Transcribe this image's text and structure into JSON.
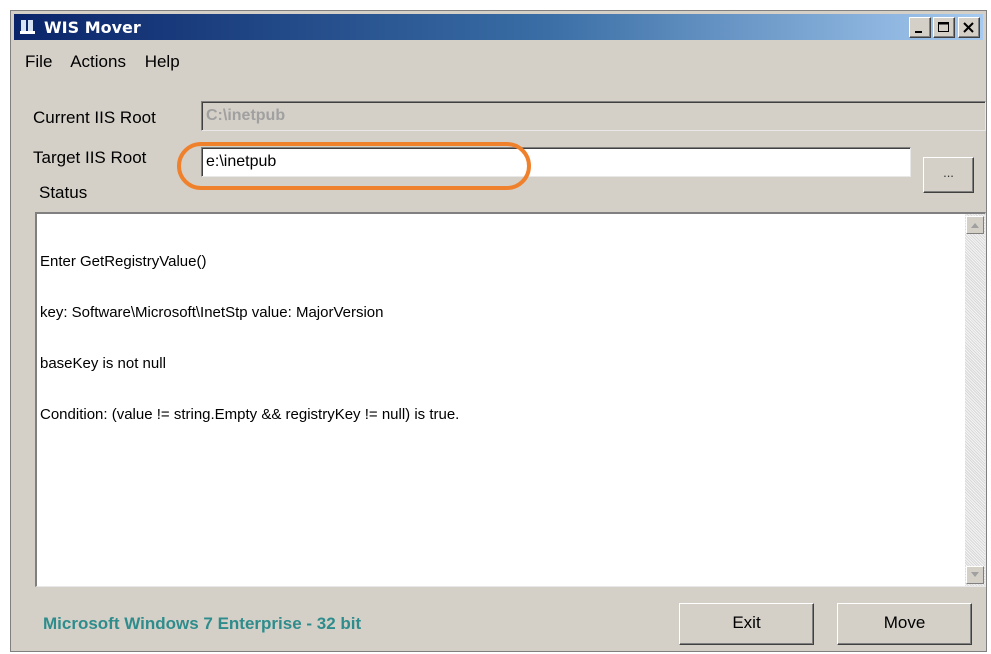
{
  "window": {
    "title": "WIS Mover",
    "icon": "app-people-icon"
  },
  "menu": {
    "items": [
      "File",
      "Actions",
      "Help"
    ]
  },
  "current_root": {
    "label": "Current IIS Root",
    "value": "C:\\inetpub"
  },
  "target_root": {
    "label": "Target IIS Root",
    "value": "e:\\inetpub",
    "browse_label": "..."
  },
  "status": {
    "label": "Status",
    "lines": [
      "Enter GetRegistryValue()",
      "key: Software\\Microsoft\\InetStp value: MajorVersion",
      "baseKey is not null",
      "Condition: (value != string.Empty && registryKey != null) is true."
    ]
  },
  "footer": {
    "os_info": "Microsoft Windows 7 Enterprise  - 32 bit",
    "exit_label": "Exit",
    "move_label": "Move"
  },
  "colors": {
    "highlight": "#f0812c",
    "os_info": "#2e8c8c"
  }
}
